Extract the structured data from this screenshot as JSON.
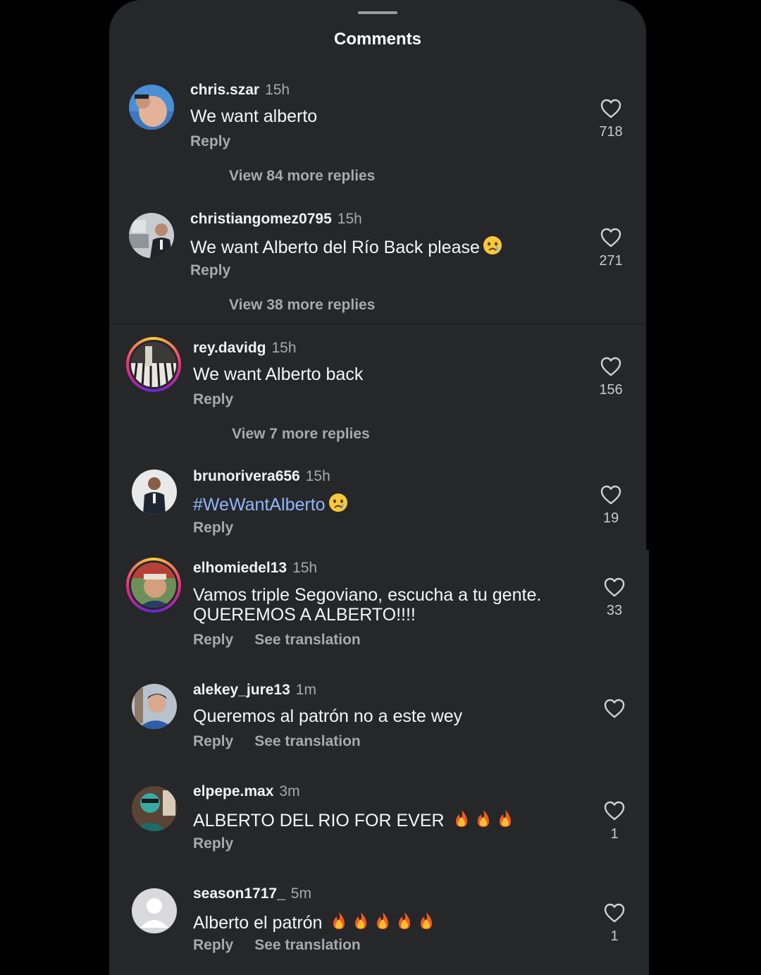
{
  "header": {
    "title": "Comments"
  },
  "comments": [
    {
      "username": "chris.szar",
      "time": "15h",
      "text": "We want alberto",
      "reply_label": "Reply",
      "likes": "718",
      "view_replies": "View 84 more replies"
    },
    {
      "username": "christiangomez0795",
      "time": "15h",
      "text": "We want Alberto del Río Back  please",
      "emoji": "😢",
      "reply_label": "Reply",
      "likes": "271",
      "view_replies": "View 38 more replies"
    },
    {
      "username": "rey.davidg",
      "time": "15h",
      "text": "We want Alberto back",
      "reply_label": "Reply",
      "likes": "156",
      "view_replies": "View 7 more replies"
    },
    {
      "username": "brunorivera656",
      "time": "15h",
      "text": "#WeWantAlberto",
      "emoji": "😢",
      "reply_label": "Reply",
      "likes": "19"
    },
    {
      "username": "elhomiedel13",
      "time": "15h",
      "text_line1": "Vamos triple Segoviano, escucha a tu gente.",
      "text_line2": "QUEREMOS A ALBERTO!!!!",
      "reply_label": "Reply",
      "translate_label": "See translation",
      "likes": "33"
    },
    {
      "username": "alekey_jure13",
      "time": "1m",
      "text": "Queremos al patrón no a este wey",
      "reply_label": "Reply",
      "translate_label": "See translation"
    },
    {
      "username": "elpepe.max",
      "time": "3m",
      "text": "ALBERTO DEL RIO FOR EVER",
      "emoji": "🔥🔥🔥",
      "reply_label": "Reply",
      "likes": "1"
    },
    {
      "username": "season1717_",
      "time": "5m",
      "text": "Alberto el patrón",
      "emoji": "🔥🔥🔥🔥🔥",
      "reply_label": "Reply",
      "translate_label": "See translation",
      "likes": "1"
    }
  ],
  "icons": {
    "like": "heart-outline-icon",
    "emoji_sad": "crying-face-emoji",
    "emoji_fire": "fire-emoji",
    "default_avatar": "default-user-icon"
  },
  "colors": {
    "background": "#000000",
    "sheet": "#262729",
    "hashtag": "#8fb7ff",
    "secondary_text": "#a8a9ad"
  }
}
